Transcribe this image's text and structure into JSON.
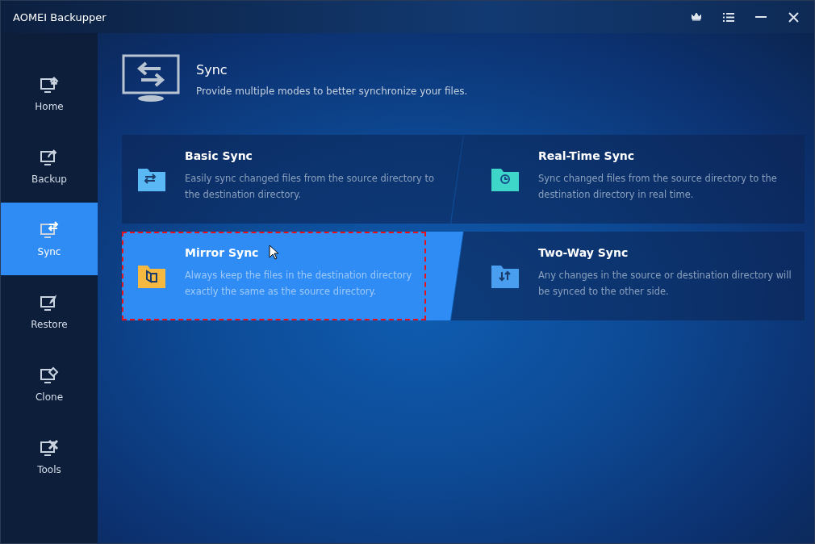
{
  "window": {
    "title": "AOMEI Backupper"
  },
  "sidebar": {
    "items": [
      {
        "label": "Home",
        "selected": false
      },
      {
        "label": "Backup",
        "selected": false
      },
      {
        "label": "Sync",
        "selected": true
      },
      {
        "label": "Restore",
        "selected": false
      },
      {
        "label": "Clone",
        "selected": false
      },
      {
        "label": "Tools",
        "selected": false
      }
    ]
  },
  "header": {
    "title": "Sync",
    "subtitle": "Provide multiple modes to better synchronize your files."
  },
  "cards": [
    {
      "title": "Basic Sync",
      "description": "Easily sync changed files from the source directory to the destination directory.",
      "color": "#5ab8f5",
      "selected": false,
      "highlighted": false
    },
    {
      "title": "Real-Time Sync",
      "description": "Sync changed files from the source directory to the destination directory in real time.",
      "color": "#3dd6c8",
      "selected": false,
      "highlighted": false
    },
    {
      "title": "Mirror Sync",
      "description": "Always keep the files in the destination directory exactly the same as the source directory.",
      "color": "#f5b942",
      "selected": true,
      "highlighted": true
    },
    {
      "title": "Two-Way Sync",
      "description": "Any changes in the source or destination directory will be synced to the other side.",
      "color": "#4a9ef0",
      "selected": false,
      "highlighted": false
    }
  ]
}
